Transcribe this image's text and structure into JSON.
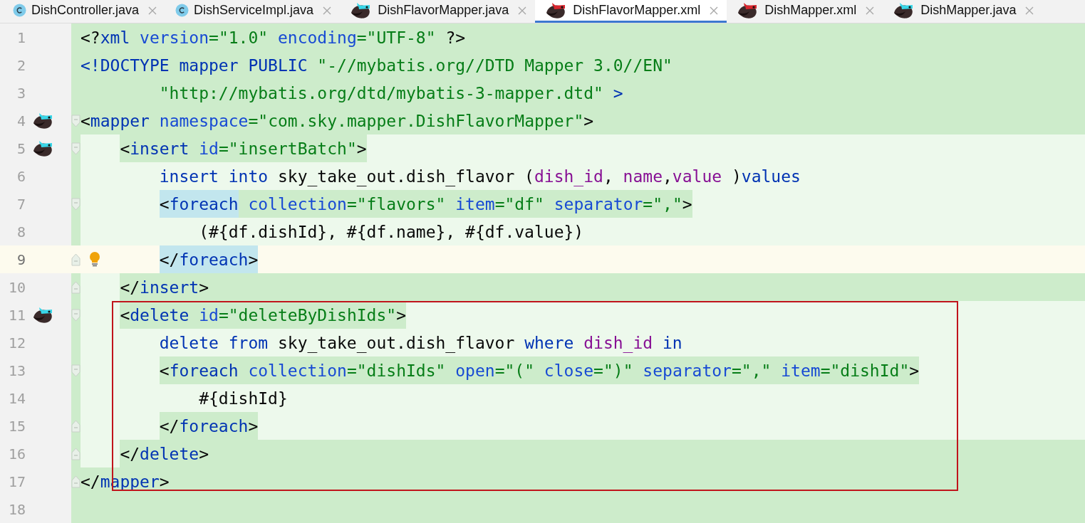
{
  "tabs": [
    {
      "label": "DishController.java",
      "kind": "class",
      "selected": false
    },
    {
      "label": "DishServiceImpl.java",
      "kind": "class",
      "selected": false
    },
    {
      "label": "DishFlavorMapper.java",
      "kind": "mapper-java",
      "selected": false
    },
    {
      "label": "DishFlavorMapper.xml",
      "kind": "mapper-xml",
      "selected": true
    },
    {
      "label": "DishMapper.xml",
      "kind": "mapper-xml",
      "selected": false
    },
    {
      "label": "DishMapper.java",
      "kind": "mapper-java",
      "selected": false
    }
  ],
  "lines": [
    {
      "number": "1",
      "kind": "full",
      "boxed": false,
      "mapped": false,
      "bulb": false,
      "fold_start": false,
      "fold_end": false,
      "tokens": [
        {
          "s": "<?",
          "kind": "bracket"
        },
        {
          "s": "xml",
          "kind": "tag"
        },
        {
          "s": " version",
          "kind": "attr"
        },
        {
          "s": "=\"1.0\"",
          "kind": "value"
        },
        {
          "s": " encoding",
          "kind": "attr"
        },
        {
          "s": "=\"UTF-8\"",
          "kind": "value"
        },
        {
          "s": " ?>",
          "kind": "bracket"
        }
      ]
    },
    {
      "number": "2",
      "kind": "full",
      "boxed": false,
      "mapped": false,
      "bulb": false,
      "fold_start": false,
      "fold_end": false,
      "tokens": [
        {
          "s": "<!DOCTYPE mapper PUBLIC ",
          "kind": "tag"
        },
        {
          "s": "\"-//mybatis.org//DTD Mapper 3.0//EN\"",
          "kind": "value"
        }
      ]
    },
    {
      "number": "3",
      "kind": "full",
      "boxed": false,
      "mapped": false,
      "bulb": false,
      "fold_start": false,
      "fold_end": false,
      "tokens": [
        {
          "s": "        \"http://mybatis.org/dtd/mybatis-3-mapper.dtd\"",
          "kind": "value"
        },
        {
          "s": " >",
          "kind": "tag"
        }
      ]
    },
    {
      "number": "4",
      "kind": "full",
      "boxed": false,
      "mapped": true,
      "bulb": false,
      "fold_start": true,
      "fold_end": false,
      "tokens": [
        {
          "s": "<",
          "kind": "bracket"
        },
        {
          "s": "mapper",
          "kind": "tag"
        },
        {
          "s": " namespace",
          "kind": "attr"
        },
        {
          "s": "=\"com.sky.mapper.DishFlavorMapper\"",
          "kind": "value"
        },
        {
          "s": ">",
          "kind": "bracket"
        }
      ],
      "children": [
        {
          "number": "5",
          "kind": "light",
          "boxed": false,
          "mapped": true,
          "bulb": false,
          "fold_start": true,
          "fold_end": false,
          "tokens": [
            {
              "s": "<",
              "kind": "bracket",
              "marked": true
            },
            {
              "s": "insert",
              "kind": "tag",
              "marked": true
            },
            {
              "s": " id",
              "kind": "attr",
              "marked": true
            },
            {
              "s": "=\"insertBatch\"",
              "kind": "value",
              "marked": true
            },
            {
              "s": ">",
              "kind": "bracket",
              "marked": true
            }
          ],
          "children": [
            {
              "number": "6",
              "kind": "light",
              "boxed": false,
              "mapped": false,
              "bulb": false,
              "fold_start": false,
              "fold_end": false,
              "tokens": [
                {
                  "s": "insert into",
                  "kind": "keyword",
                  "marked": false
                },
                {
                  "s": " sky_take_out.dish_flavor (",
                  "kind": "text",
                  "marked": false
                },
                {
                  "s": "dish_id",
                  "kind": "column",
                  "marked": false
                },
                {
                  "s": ", ",
                  "kind": "text",
                  "marked": false
                },
                {
                  "s": "name",
                  "kind": "column",
                  "marked": false
                },
                {
                  "s": ",",
                  "kind": "text",
                  "marked": false
                },
                {
                  "s": "value",
                  "kind": "column",
                  "marked": false
                },
                {
                  "s": " )",
                  "kind": "text",
                  "marked": false
                },
                {
                  "s": "values",
                  "kind": "keyword",
                  "marked": false
                }
              ]
            },
            {
              "number": "7",
              "kind": "light",
              "boxed": false,
              "mapped": false,
              "bulb": false,
              "fold_start": true,
              "fold_end": false,
              "tokens": [
                {
                  "s": "<",
                  "kind": "bracket",
                  "marked": false,
                  "matched": true
                },
                {
                  "s": "foreach",
                  "kind": "tag",
                  "marked": false,
                  "matched": true
                },
                {
                  "s": " collection",
                  "kind": "attr",
                  "marked": true,
                  "matched": false
                },
                {
                  "s": "=\"flavors\"",
                  "kind": "value",
                  "marked": true,
                  "matched": false
                },
                {
                  "s": " item",
                  "kind": "attr",
                  "marked": true,
                  "matched": false
                },
                {
                  "s": "=\"df\"",
                  "kind": "value",
                  "marked": true,
                  "matched": false
                },
                {
                  "s": " separator",
                  "kind": "attr",
                  "marked": true,
                  "matched": false
                },
                {
                  "s": "=\",\"",
                  "kind": "value",
                  "marked": true,
                  "matched": false
                },
                {
                  "s": ">",
                  "kind": "bracket",
                  "marked": true,
                  "matched": false
                }
              ],
              "children": [
                {
                  "number": "8",
                  "kind": "light",
                  "boxed": false,
                  "mapped": false,
                  "bulb": false,
                  "fold_start": false,
                  "fold_end": false,
                  "tokens": [
                    {
                      "s": "(#{df.dishId}, #{df.name}, #{df.value})",
                      "kind": "text",
                      "marked": false
                    }
                  ]
                }
              ]
            },
            {
              "number": "9",
              "kind": "current",
              "boxed": false,
              "mapped": false,
              "bulb": true,
              "fold_start": false,
              "fold_end": true,
              "tokens": [
                {
                  "s": "</",
                  "kind": "bracket",
                  "marked": false,
                  "matched": true
                },
                {
                  "s": "foreach",
                  "kind": "tag",
                  "marked": false,
                  "matched": true
                },
                {
                  "s": ">",
                  "kind": "bracket",
                  "marked": false,
                  "matched": true
                }
              ]
            }
          ]
        },
        {
          "number": "10",
          "kind": "split",
          "boxed": false,
          "mapped": false,
          "bulb": false,
          "fold_start": false,
          "fold_end": true,
          "tokens": [
            {
              "s": "</",
              "kind": "bracket"
            },
            {
              "s": "insert",
              "kind": "tag"
            },
            {
              "s": ">",
              "kind": "bracket"
            }
          ]
        },
        {
          "number": "11",
          "kind": "light",
          "boxed": true,
          "mapped": true,
          "bulb": false,
          "fold_start": true,
          "fold_end": false,
          "tokens": [
            {
              "s": "<",
              "kind": "bracket",
              "marked": true
            },
            {
              "s": "delete",
              "kind": "tag",
              "marked": true
            },
            {
              "s": " id",
              "kind": "attr",
              "marked": true
            },
            {
              "s": "=\"deleteByDishIds\"",
              "kind": "value",
              "marked": true
            },
            {
              "s": ">",
              "kind": "bracket",
              "marked": true
            }
          ],
          "children": [
            {
              "number": "12",
              "kind": "light",
              "boxed": true,
              "mapped": false,
              "bulb": false,
              "fold_start": false,
              "fold_end": false,
              "tokens": [
                {
                  "s": "delete from",
                  "kind": "keyword",
                  "marked": false
                },
                {
                  "s": " sky_take_out.dish_flavor ",
                  "kind": "text",
                  "marked": false
                },
                {
                  "s": "where ",
                  "kind": "keyword",
                  "marked": false
                },
                {
                  "s": "dish_id ",
                  "kind": "column",
                  "marked": false
                },
                {
                  "s": "in",
                  "kind": "keyword",
                  "marked": false
                }
              ]
            },
            {
              "number": "13",
              "kind": "light",
              "boxed": true,
              "mapped": false,
              "bulb": false,
              "fold_start": true,
              "fold_end": false,
              "tokens": [
                {
                  "s": "<",
                  "kind": "bracket",
                  "marked": true
                },
                {
                  "s": "foreach",
                  "kind": "tag",
                  "marked": true
                },
                {
                  "s": " collection",
                  "kind": "attr",
                  "marked": true
                },
                {
                  "s": "=\"dishIds\"",
                  "kind": "value",
                  "marked": true
                },
                {
                  "s": " open",
                  "kind": "attr",
                  "marked": true
                },
                {
                  "s": "=\"(\"",
                  "kind": "value",
                  "marked": true
                },
                {
                  "s": " close",
                  "kind": "attr",
                  "marked": true
                },
                {
                  "s": "=\")\"",
                  "kind": "value",
                  "marked": true
                },
                {
                  "s": " separator",
                  "kind": "attr",
                  "marked": true
                },
                {
                  "s": "=\",\"",
                  "kind": "value",
                  "marked": true
                },
                {
                  "s": " item",
                  "kind": "attr",
                  "marked": true
                },
                {
                  "s": "=\"dishId\"",
                  "kind": "value",
                  "marked": true
                },
                {
                  "s": ">",
                  "kind": "bracket",
                  "marked": true
                }
              ],
              "children": [
                {
                  "number": "14",
                  "kind": "light",
                  "boxed": true,
                  "mapped": false,
                  "bulb": false,
                  "fold_start": false,
                  "fold_end": false,
                  "tokens": [
                    {
                      "s": "#{dishId}",
                      "kind": "text",
                      "marked": false
                    }
                  ]
                }
              ]
            },
            {
              "number": "15",
              "kind": "light",
              "boxed": true,
              "mapped": false,
              "bulb": false,
              "fold_start": false,
              "fold_end": true,
              "tokens": [
                {
                  "s": "</",
                  "kind": "bracket",
                  "marked": true
                },
                {
                  "s": "foreach",
                  "kind": "tag",
                  "marked": true
                },
                {
                  "s": ">",
                  "kind": "bracket",
                  "marked": true
                }
              ]
            }
          ]
        },
        {
          "number": "16",
          "kind": "split",
          "boxed": true,
          "mapped": false,
          "bulb": false,
          "fold_start": false,
          "fold_end": true,
          "tokens": [
            {
              "s": "</",
              "kind": "bracket"
            },
            {
              "s": "delete",
              "kind": "tag"
            },
            {
              "s": ">",
              "kind": "bracket"
            }
          ]
        }
      ]
    },
    {
      "number": "17",
      "kind": "full",
      "boxed": false,
      "mapped": false,
      "bulb": false,
      "fold_start": false,
      "fold_end": true,
      "tokens": [
        {
          "s": "</",
          "kind": "bracket"
        },
        {
          "s": "mapper",
          "kind": "tag"
        },
        {
          "s": ">",
          "kind": "bracket"
        }
      ]
    },
    {
      "number": "18",
      "kind": "full",
      "boxed": false,
      "mapped": false,
      "bulb": false,
      "fold_start": false,
      "fold_end": false
    }
  ]
}
